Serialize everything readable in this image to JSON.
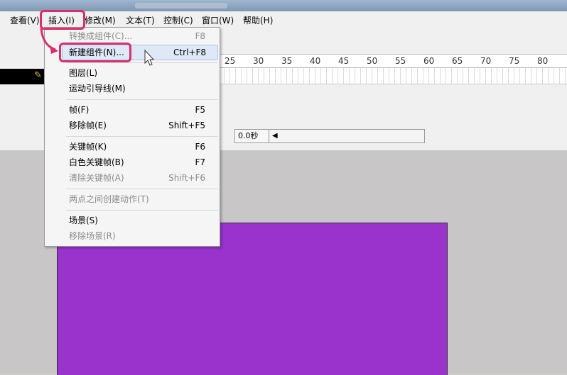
{
  "menubar": {
    "items": [
      "查看(V)",
      "插入(I)",
      "修改(M)",
      "文本(T)",
      "控制(C)",
      "窗口(W)",
      "帮助(H)"
    ]
  },
  "timeline": {
    "ruler_ticks": [
      "25",
      "30",
      "35",
      "40",
      "45",
      "50",
      "55",
      "60",
      "65",
      "70",
      "75",
      "80"
    ],
    "time_readout": "0.0秒"
  },
  "insert_menu": {
    "items": [
      {
        "label": "转换成组件(C)...",
        "shortcut": "F8",
        "disabled": true
      },
      {
        "label": "新建组件(N)...",
        "shortcut": "Ctrl+F8",
        "disabled": false,
        "highlighted": true
      },
      {
        "label": "图层(L)",
        "shortcut": "",
        "disabled": false
      },
      {
        "label": "运动引导线(M)",
        "shortcut": "",
        "disabled": false
      },
      {
        "label": "帧(F)",
        "shortcut": "F5",
        "disabled": false
      },
      {
        "label": "移除帧(E)",
        "shortcut": "Shift+F5",
        "disabled": false
      },
      {
        "label": "关键帧(K)",
        "shortcut": "F6",
        "disabled": false
      },
      {
        "label": "白色关键帧(B)",
        "shortcut": "F7",
        "disabled": false
      },
      {
        "label": "清除关键帧(A)",
        "shortcut": "Shift+F6",
        "disabled": true
      },
      {
        "label": "两点之间创建动作(T)",
        "shortcut": "",
        "disabled": true
      },
      {
        "label": "场景(S)",
        "shortcut": "",
        "disabled": false
      },
      {
        "label": "移除场景(R)",
        "shortcut": "",
        "disabled": true
      }
    ]
  },
  "colors": {
    "stage_shape": "#9933cc",
    "highlight_ring": "#d92f6b"
  }
}
